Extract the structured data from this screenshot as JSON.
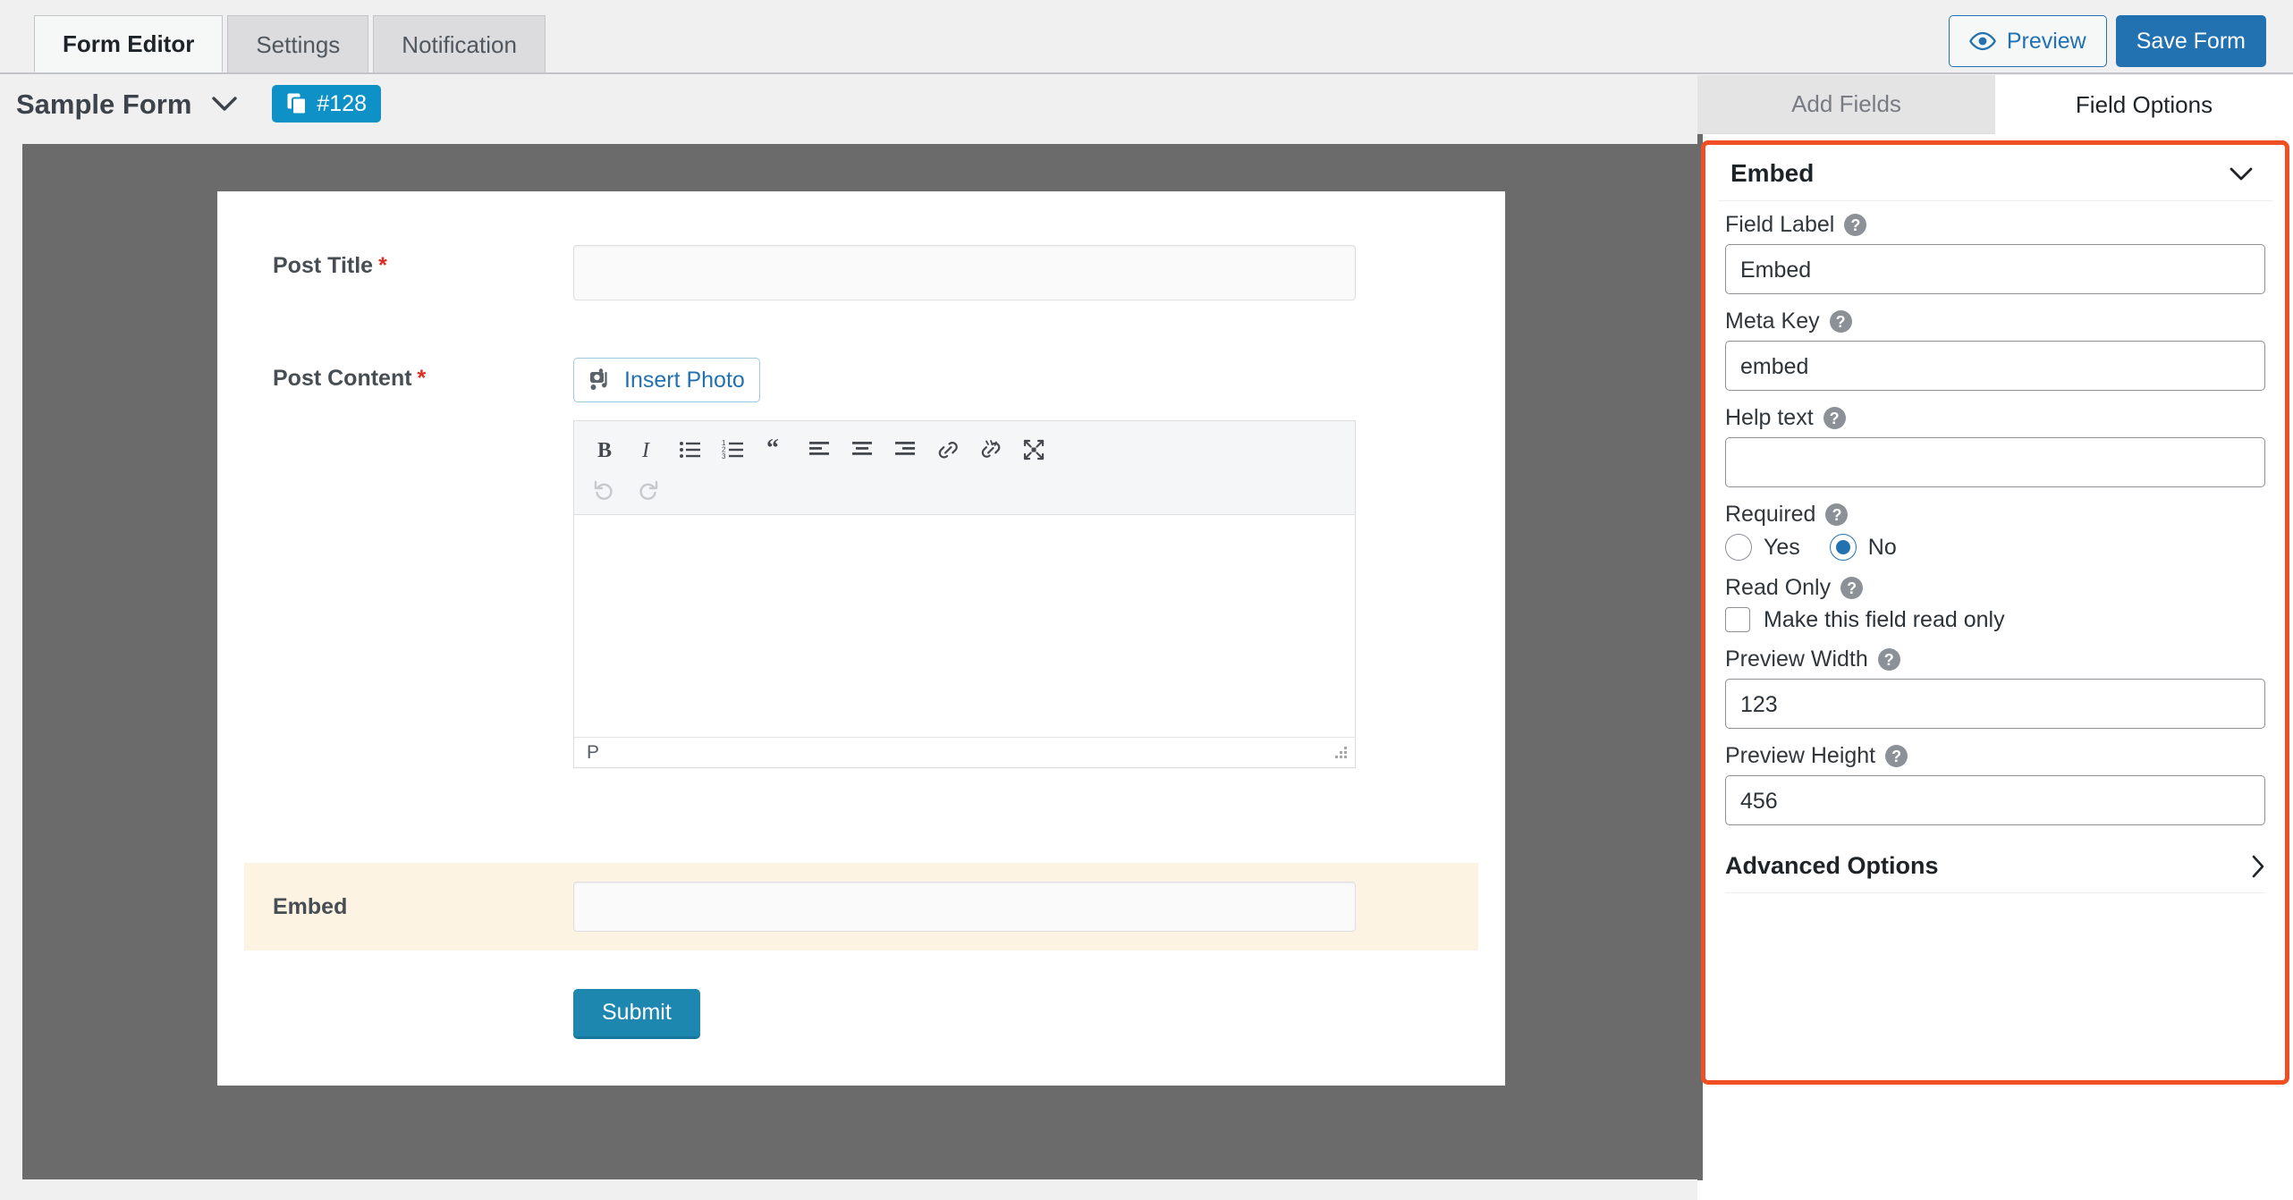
{
  "topbar": {
    "tabs": [
      {
        "label": "Form Editor",
        "active": true
      },
      {
        "label": "Settings",
        "active": false
      },
      {
        "label": "Notification",
        "active": false
      }
    ],
    "preview_label": "Preview",
    "save_label": "Save Form",
    "preview_icon": "eye-icon",
    "accent_blue": "#2271b1"
  },
  "formheader": {
    "title": "Sample Form",
    "caret_icon": "chevron-down-icon",
    "badge_label": "#128",
    "badge_icon": "copy-icon",
    "badge_color": "#0e91c6"
  },
  "panel_tabs": [
    {
      "label": "Add Fields",
      "active": false
    },
    {
      "label": "Field Options",
      "active": true
    }
  ],
  "preview": {
    "fields": [
      {
        "label": "Post Title",
        "required": true,
        "value": "",
        "type": "text"
      },
      {
        "label": "Post Content",
        "required": true,
        "value": "",
        "type": "richtext"
      },
      {
        "label": "Embed",
        "required": false,
        "value": "",
        "type": "text",
        "highlighted": true
      }
    ],
    "insert_photo_label": "Insert Photo",
    "insert_photo_icon": "photo-icon",
    "editor_toolbar_row1": [
      "bold-icon",
      "italic-icon",
      "bulleted-list-icon",
      "numbered-list-icon",
      "blockquote-icon",
      "align-left-icon",
      "align-center-icon",
      "align-right-icon",
      "link-icon",
      "unlink-icon",
      "fullscreen-icon"
    ],
    "editor_toolbar_row2": [
      "undo-icon",
      "redo-icon"
    ],
    "editor_status_text": "P",
    "editor_resize_icon": "resize-grip-icon",
    "submit_label": "Submit",
    "submit_color": "#1e87b0",
    "highlight_color": "#fcf3e3",
    "canvas_color": "#6b6b6b"
  },
  "field_options": {
    "panel_title": "Embed",
    "panel_collapse_icon": "chevron-down-icon",
    "highlight_border_color": "#f04e23",
    "groups": [
      {
        "label": "Field Label",
        "help_icon": "help-icon",
        "value": "Embed"
      },
      {
        "label": "Meta Key",
        "help_icon": "help-icon",
        "value": "embed"
      },
      {
        "label": "Help text",
        "help_icon": "help-icon",
        "value": ""
      }
    ],
    "required": {
      "label": "Required",
      "help_icon": "help-icon",
      "options": [
        {
          "label": "Yes",
          "selected": false
        },
        {
          "label": "No",
          "selected": true
        }
      ]
    },
    "read_only": {
      "label": "Read Only",
      "help_icon": "help-icon",
      "checkbox_label": "Make this field read only",
      "checked": false
    },
    "preview_width": {
      "label": "Preview Width",
      "help_icon": "help-icon",
      "value": "123"
    },
    "preview_height": {
      "label": "Preview Height",
      "help_icon": "help-icon",
      "value": "456"
    },
    "advanced": {
      "label": "Advanced Options",
      "icon": "chevron-right-icon"
    }
  }
}
